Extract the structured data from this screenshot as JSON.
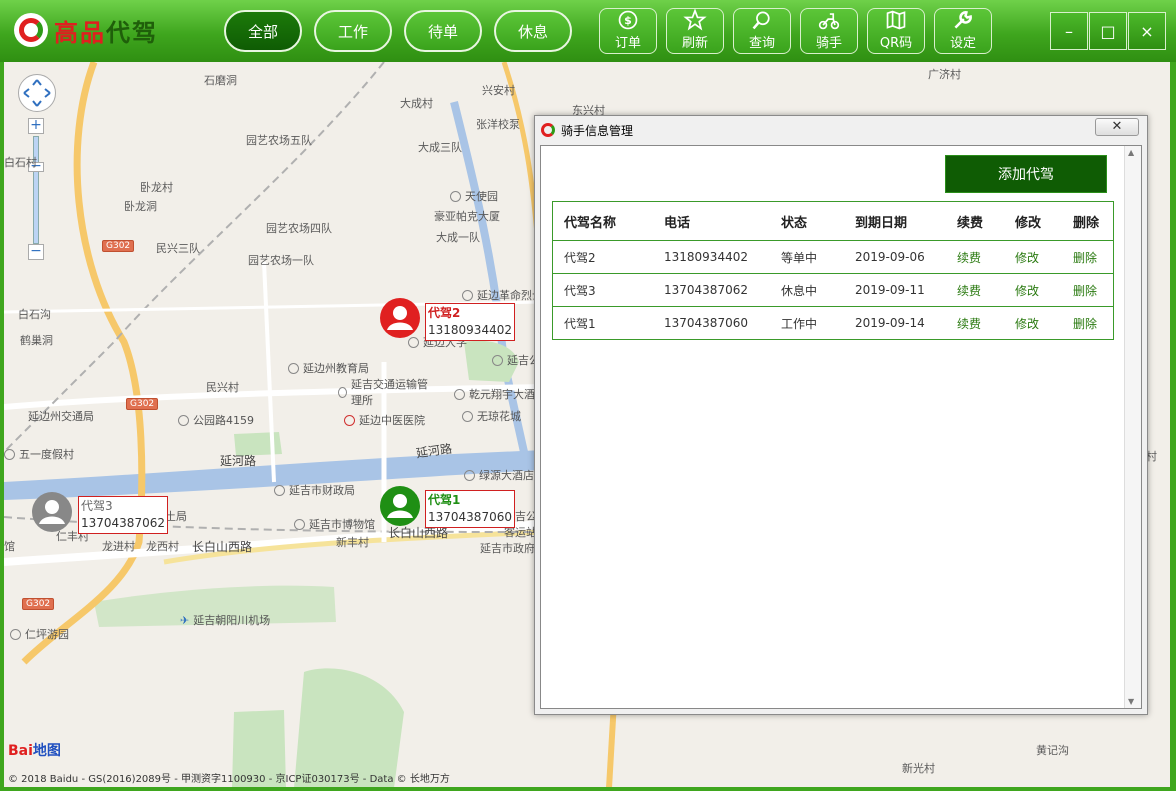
{
  "app": {
    "logo_main": "高品",
    "logo_sub": "代驾"
  },
  "nav_tabs": [
    {
      "label": "全部",
      "active": true
    },
    {
      "label": "工作",
      "active": false
    },
    {
      "label": "待单",
      "active": false
    },
    {
      "label": "休息",
      "active": false
    }
  ],
  "toolbar": [
    {
      "label": "订单",
      "icon": "money-icon"
    },
    {
      "label": "刷新",
      "icon": "star-icon"
    },
    {
      "label": "查询",
      "icon": "search-icon"
    },
    {
      "label": "骑手",
      "icon": "scooter-icon"
    },
    {
      "label": "QR码",
      "icon": "map-icon"
    },
    {
      "label": "设定",
      "icon": "wrench-icon"
    }
  ],
  "window_controls": {
    "minimize": "–",
    "maximize": "□",
    "close": "×"
  },
  "map": {
    "places": [
      {
        "text": "石磨洞"
      },
      {
        "text": "兴安村"
      },
      {
        "text": "大成村"
      },
      {
        "text": "张洋校泵"
      },
      {
        "text": "东兴村"
      },
      {
        "text": "园艺农场五队"
      },
      {
        "text": "大成三队"
      },
      {
        "text": "白石村"
      },
      {
        "text": "卧龙村"
      },
      {
        "text": "卧龙洞"
      },
      {
        "text": "天使园"
      },
      {
        "text": "豪亚帕克大厦"
      },
      {
        "text": "园艺农场四队"
      },
      {
        "text": "大成一队"
      },
      {
        "text": "民兴三队"
      },
      {
        "text": "园艺农场一队"
      },
      {
        "text": "延边革命烈士陵园"
      },
      {
        "text": "白石沟"
      },
      {
        "text": "鹤巢洞"
      },
      {
        "text": "延边州教育局"
      },
      {
        "text": "延边大学"
      },
      {
        "text": "延吉公"
      },
      {
        "text": "民兴村"
      },
      {
        "text": "延吉交通运输管理所"
      },
      {
        "text": "乾元翔宇大酒"
      },
      {
        "text": "延边州交通局"
      },
      {
        "text": "公园路4159"
      },
      {
        "text": "延边中医医院"
      },
      {
        "text": "无琼花城"
      },
      {
        "text": "五一度假村"
      },
      {
        "text": "延河路"
      },
      {
        "text": "延吉市财政局"
      },
      {
        "text": "绿源大酒店"
      },
      {
        "text": "国土局"
      },
      {
        "text": "延吉市博物馆"
      },
      {
        "text": "延吉公客运站"
      },
      {
        "text": "仁丰村"
      },
      {
        "text": "龙进村"
      },
      {
        "text": "龙西村"
      },
      {
        "text": "长白山西路"
      },
      {
        "text": "新丰村"
      },
      {
        "text": "长白山西路"
      },
      {
        "text": "延吉市政府"
      },
      {
        "text": "延吉朝阳川机场"
      },
      {
        "text": "仁坪游园"
      },
      {
        "text": "广济村"
      },
      {
        "text": "黄记沟"
      },
      {
        "text": "新光村"
      },
      {
        "text": "馆"
      },
      {
        "text": "村"
      }
    ],
    "shields": [
      "G302",
      "G302",
      "G302"
    ],
    "zoom_in": "+",
    "zoom_out": "−",
    "copyright": "© 2018 Baidu - GS(2016)2089号 - 甲测资字1100930 - 京ICP证030173号 - Data © 长地万方",
    "baidu_logo_a": "Bai",
    "baidu_logo_b": "地图",
    "markers": [
      {
        "name": "代驾2",
        "phone": "13180934402",
        "status_color": "#e02020"
      },
      {
        "name": "代驾1",
        "phone": "13704387060",
        "status_color": "#1f8f14"
      },
      {
        "name": "代驾3",
        "phone": "13704387062",
        "status_color": "#888888"
      }
    ]
  },
  "dialog": {
    "title": "骑手信息管理",
    "close": "✕",
    "add_button": "添加代驾",
    "columns": [
      "代驾名称",
      "电话",
      "状态",
      "到期日期",
      "续费",
      "修改",
      "删除"
    ],
    "rows": [
      {
        "name": "代驾2",
        "phone": "13180934402",
        "status": "等单中",
        "expire": "2019-09-06",
        "renew": "续费",
        "edit": "修改",
        "delete": "删除"
      },
      {
        "name": "代驾3",
        "phone": "13704387062",
        "status": "休息中",
        "expire": "2019-09-11",
        "renew": "续费",
        "edit": "修改",
        "delete": "删除"
      },
      {
        "name": "代驾1",
        "phone": "13704387060",
        "status": "工作中",
        "expire": "2019-09-14",
        "renew": "续费",
        "edit": "修改",
        "delete": "删除"
      }
    ]
  }
}
